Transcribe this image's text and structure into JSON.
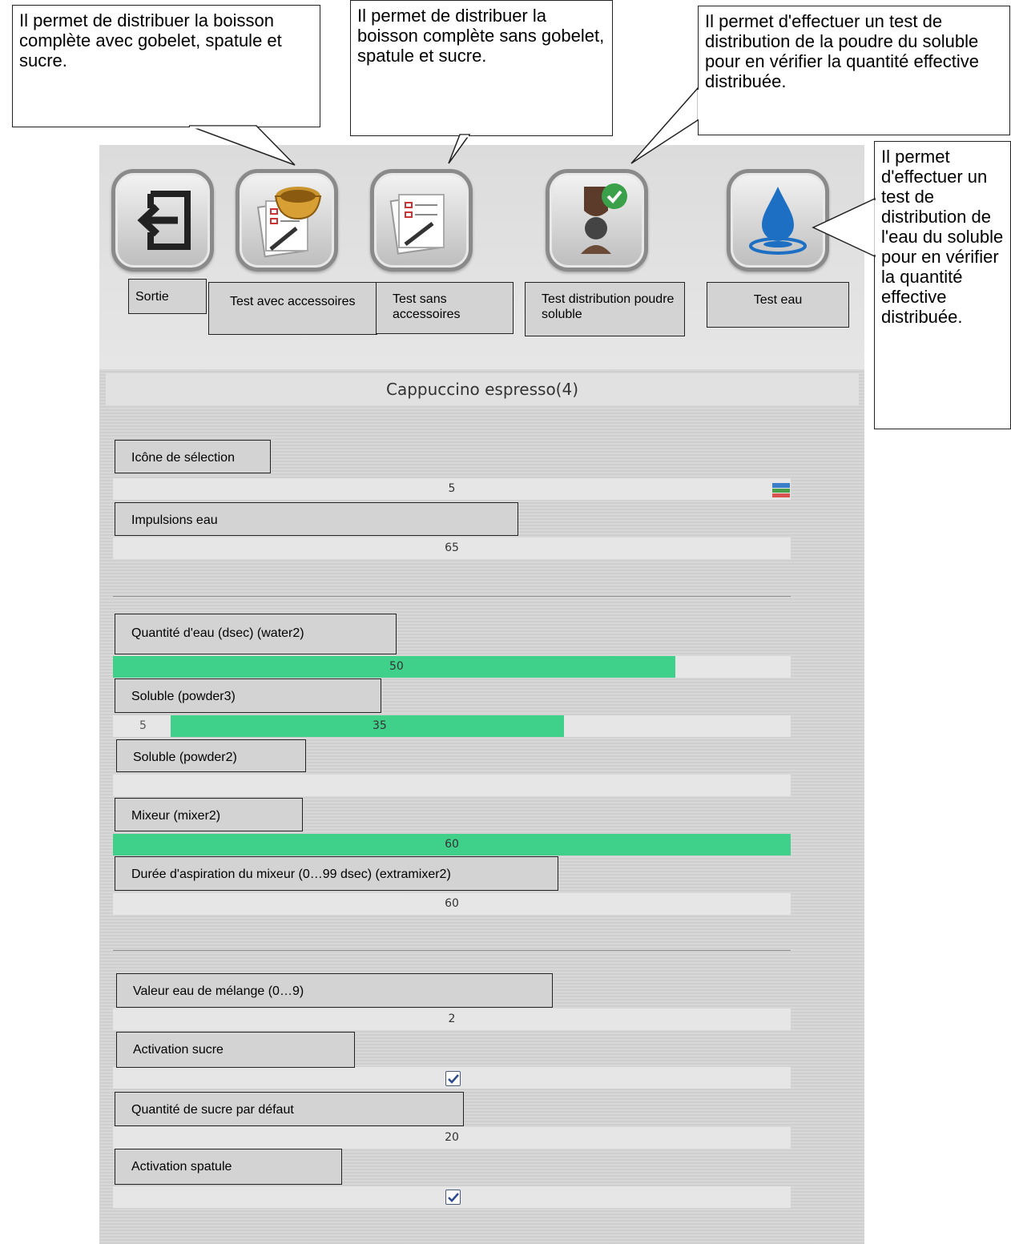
{
  "callouts": {
    "c1": "Il permet de distribuer la boisson complète avec gobelet, spatule et sucre.",
    "c2": "Il permet de distribuer la boisson complète sans gobelet, spatule et sucre.",
    "c3": "Il permet d'effectuer un test de distribution de la poudre du soluble pour en vérifier la quantité effective distribuée.",
    "c4": "Il permet d'effectuer un test de distribution de l'eau du soluble pour en vérifier la quantité effective distribuée."
  },
  "toolbar": {
    "exit": "Sortie",
    "test_with": "Test avec accessoires",
    "test_without": "Test sans accessoires",
    "test_powder": "Test distribution poudre soluble",
    "test_water": "Test eau"
  },
  "screen_title": "Cappuccino espresso(4)",
  "fields": {
    "icon_sel": {
      "label": "Icône de sélection",
      "value": "5"
    },
    "water_pulses": {
      "label": "Impulsions eau",
      "value": "65"
    },
    "water_qty": {
      "label": "Quantité d'eau (dsec) (water2)",
      "value": "50",
      "fill": 0.83
    },
    "powder3": {
      "label": "Soluble (powder3)",
      "value": "35",
      "start": "5",
      "fill": 0.665
    },
    "powder2": {
      "label": "Soluble (powder2)",
      "value": ""
    },
    "mixer": {
      "label": "Mixeur (mixer2)",
      "value": "60",
      "fill": 1.0
    },
    "extramixer": {
      "label": "Durée d'aspiration du mixeur (0…99 dsec) (extramixer2)",
      "value": "60"
    },
    "mix_water": {
      "label": "Valeur eau de mélange (0…9)",
      "value": "2"
    },
    "sugar_on": {
      "label": "Activation sucre",
      "checked": true
    },
    "sugar_default": {
      "label": "Quantité de sucre par défaut",
      "value": "20"
    },
    "spatula_on": {
      "label": "Activation spatule",
      "checked": true
    }
  },
  "colors": {
    "accent_green": "#3fd08a",
    "screen_bg": "#d6d6d6"
  },
  "icons": [
    "exit-icon",
    "test-with-accessories-icon",
    "test-without-accessories-icon",
    "powder-test-icon",
    "water-drop-icon",
    "color-stack-icon",
    "checkbox-check-icon"
  ]
}
